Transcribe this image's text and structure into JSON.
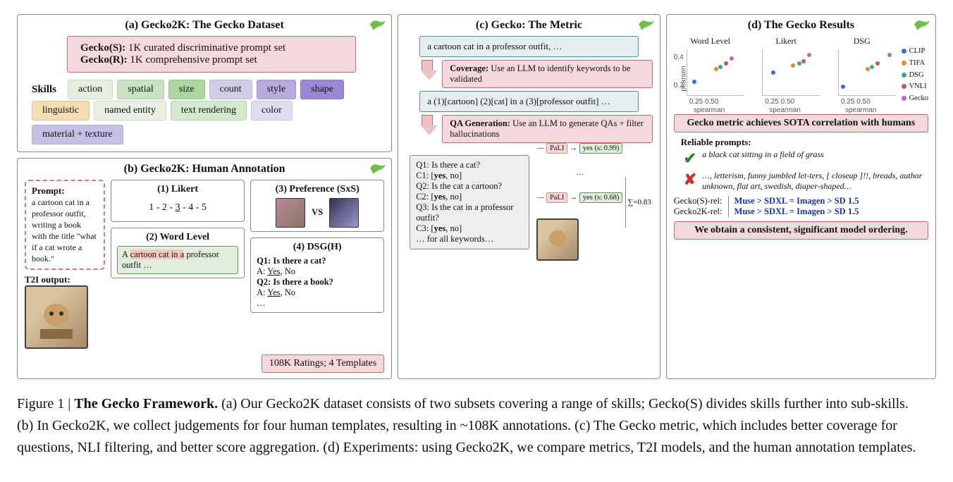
{
  "panels": {
    "a": {
      "title": "(a) Gecko2K: The Gecko Dataset",
      "subset_s_label": "Gecko(S):",
      "subset_s_text": " 1K curated discriminative prompt set",
      "subset_r_label": "Gecko(R):",
      "subset_r_text": " 1K comprehensive prompt set",
      "skills_label": "Skills",
      "skills_row1": [
        "action",
        "spatial",
        "size",
        "count",
        "style",
        "shape"
      ],
      "skills_row2": [
        "linguistic",
        "named entity",
        "text rendering",
        "color",
        "material + texture"
      ]
    },
    "b": {
      "title": "(b) Gecko2K: Human Annotation",
      "prompt_label": "Prompt:",
      "prompt_text": "a cartoon cat in a professor outfit, writing a book with the title \"what if a cat wrote a book.\"",
      "t2i_label": "T2I output:",
      "likert_title": "(1) Likert",
      "likert_scale": "1 - 2 - 3 - 4 - 5",
      "wordlevel_title": "(2) Word Level",
      "wordlevel_text_pre": "A ",
      "wordlevel_text_hi": "cartoon cat in a",
      "wordlevel_text_post": " professor outfit …",
      "pref_title": "(3) Preference (SxS)",
      "vs_text": "VS",
      "dsg_title": "(4) DSG(H)",
      "dsg_q1": "Q1: Is there a cat?",
      "dsg_a1": "A: Yes, No",
      "dsg_q2": "Q2: Is there a book?",
      "dsg_a2": "A: Yes, No",
      "dsg_more": "…",
      "banner": "108K Ratings; 4 Templates"
    },
    "c": {
      "title": "(c) Gecko: The Metric",
      "input_prompt": "a cartoon cat in a professor outfit, …",
      "coverage_label": "Coverage:",
      "coverage_text": " Use an LLM to identify keywords to be validated",
      "tagged_prompt": "a (1)[cartoon] (2)[cat] in a (3)[professor outfit] …",
      "qa_label": "QA Generation:",
      "qa_text": " Use an LLM to generate QAs + filter hallucinations",
      "q1": "Q1: Is there a cat?",
      "c1": "C1: [yes, no]",
      "q2": "Q2: Is the cat a cartoon?",
      "c2": "C2: [yes, no]",
      "q3": "Q3: Is the cat in a professor outfit?",
      "c3": "C3: [yes, no]",
      "all_kw": "… for all keywords…",
      "pali": "PaLI",
      "yes1": "yes (s: 0.99)",
      "yes2": "yes (s: 0.68)",
      "dots": "…",
      "sigma": "∑=0.83"
    },
    "d": {
      "title": "(d) The Gecko Results",
      "chart_titles": [
        "Word Level",
        "Likert",
        "DSG"
      ],
      "ylab": "pearson",
      "xlab": "spearman",
      "xticks": [
        "0.25",
        "0.50"
      ],
      "yticks": [
        "0.2",
        "0.4"
      ],
      "legend": [
        "CLIP",
        "TIFA",
        "DSG",
        "VNLI",
        "Gecko"
      ],
      "sota": "Gecko metric achieves SOTA correlation with humans",
      "reliable_heading": "Reliable prompts:",
      "reliable_good": "a black cat sitting in a field of grass",
      "reliable_bad": "…, letterism, funny jumbled let-ters, [ closeup ]!!, breads, author unknown, flat art, swedish, diaper-shaped…",
      "rank_s_label": "Gecko(S)-rel:",
      "rank_2k_label": "Gecko2K-rel:",
      "rank_order": "Muse > SDXL = Imagen > SD 1.5",
      "ordering_banner": "We obtain a consistent, significant model ordering."
    }
  },
  "chart_data": [
    {
      "type": "scatter",
      "title": "Word Level",
      "xlabel": "spearman",
      "ylabel": "pearson",
      "xlim": [
        0.15,
        0.55
      ],
      "ylim": [
        0.1,
        0.5
      ],
      "series": [
        {
          "name": "CLIP",
          "x": [
            0.2
          ],
          "y": [
            0.22
          ]
        },
        {
          "name": "TIFA",
          "x": [
            0.35
          ],
          "y": [
            0.33
          ]
        },
        {
          "name": "DSG",
          "x": [
            0.38
          ],
          "y": [
            0.35
          ]
        },
        {
          "name": "VNLI",
          "x": [
            0.42
          ],
          "y": [
            0.38
          ]
        },
        {
          "name": "Gecko",
          "x": [
            0.46
          ],
          "y": [
            0.42
          ]
        }
      ]
    },
    {
      "type": "scatter",
      "title": "Likert",
      "xlabel": "spearman",
      "ylabel": "pearson",
      "xlim": [
        0.15,
        0.55
      ],
      "ylim": [
        0.1,
        0.5
      ],
      "series": [
        {
          "name": "CLIP",
          "x": [
            0.22
          ],
          "y": [
            0.3
          ]
        },
        {
          "name": "TIFA",
          "x": [
            0.36
          ],
          "y": [
            0.36
          ]
        },
        {
          "name": "DSG",
          "x": [
            0.4
          ],
          "y": [
            0.38
          ]
        },
        {
          "name": "VNLI",
          "x": [
            0.43
          ],
          "y": [
            0.4
          ]
        },
        {
          "name": "Gecko",
          "x": [
            0.47
          ],
          "y": [
            0.45
          ]
        }
      ]
    },
    {
      "type": "scatter",
      "title": "DSG",
      "xlabel": "spearman",
      "ylabel": "pearson",
      "xlim": [
        0.15,
        0.55
      ],
      "ylim": [
        0.1,
        0.5
      ],
      "series": [
        {
          "name": "CLIP",
          "x": [
            0.18
          ],
          "y": [
            0.18
          ]
        },
        {
          "name": "TIFA",
          "x": [
            0.35
          ],
          "y": [
            0.33
          ]
        },
        {
          "name": "DSG",
          "x": [
            0.38
          ],
          "y": [
            0.35
          ]
        },
        {
          "name": "VNLI",
          "x": [
            0.42
          ],
          "y": [
            0.38
          ]
        },
        {
          "name": "Gecko",
          "x": [
            0.5
          ],
          "y": [
            0.45
          ]
        }
      ]
    }
  ],
  "colors": {
    "CLIP": "#3a6cc8",
    "TIFA": "#d98b39",
    "DSG": "#3aa88a",
    "VNLI": "#c85a4a",
    "Gecko": "#b06ac8"
  },
  "skill_colors": {
    "action": "#e5efe0",
    "spatial": "#c9e3c0",
    "size": "#aed6a1",
    "count": "#d3cce8",
    "style": "#b7abe0",
    "shape": "#9a88d6",
    "linguistic": "#f6dcb4",
    "named entity": "#e8f1e4",
    "text rendering": "#d3e8cc",
    "color": "#e1dcf0",
    "material + texture": "#c8bfe6"
  },
  "caption": {
    "label": "Figure 1 | ",
    "title": "The Gecko Framework.",
    "text": " (a) Our Gecko2K dataset consists of two subsets covering a range of skills; Gecko(S) divides skills further into sub-skills. (b) In Gecko2K, we collect judgements for four human templates, resulting in ~108K annotations. (c) The Gecko metric, which includes better coverage for questions, NLI filtering, and better score aggregation. (d) Experiments: using Gecko2K, we compare metrics, T2I models, and the human annotation templates."
  }
}
